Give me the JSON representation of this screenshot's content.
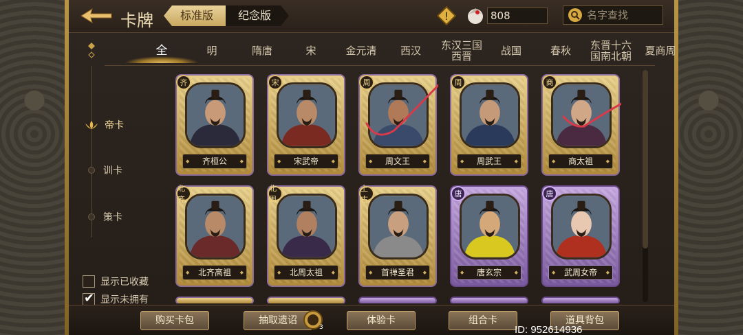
{
  "header": {
    "title": "卡牌",
    "version_tabs": [
      {
        "label": "标准版",
        "active": true
      },
      {
        "label": "纪念版",
        "active": false
      }
    ],
    "currency_amount": "808",
    "search_placeholder": "名字查找"
  },
  "era_tabs": [
    {
      "label": "全",
      "active": true
    },
    {
      "label": "明"
    },
    {
      "label": "隋唐"
    },
    {
      "label": "宋"
    },
    {
      "label": "金元清"
    },
    {
      "label": "西汉"
    },
    {
      "label": "东汉三国\n西晋"
    },
    {
      "label": "战国"
    },
    {
      "label": "春秋"
    },
    {
      "label": "东晋十六\n国南北朝"
    },
    {
      "label": "夏商周"
    }
  ],
  "categories": [
    {
      "label": "帝卡",
      "active": true
    },
    {
      "label": "训卡"
    },
    {
      "label": "策卡"
    }
  ],
  "filters": [
    {
      "label": "显示已收藏",
      "checked": false
    },
    {
      "label": "显示未拥有",
      "checked": true
    }
  ],
  "cards": [
    {
      "name": "齐桓公",
      "era": "齐",
      "tier": "gold",
      "skin": "#c89a78",
      "robe": "#2a2a3a",
      "marked": false
    },
    {
      "name": "宋武帝",
      "era": "宋",
      "tier": "gold",
      "skin": "#b88a68",
      "robe": "#7a2a20",
      "marked": false
    },
    {
      "name": "周文王",
      "era": "周",
      "tier": "gold",
      "skin": "#b07a58",
      "robe": "#3a4a6a",
      "marked": true
    },
    {
      "name": "周武王",
      "era": "周",
      "tier": "gold",
      "skin": "#c49a78",
      "robe": "#2a3a5a",
      "marked": false
    },
    {
      "name": "商太祖",
      "era": "商",
      "tier": "gold",
      "skin": "#d0a888",
      "robe": "#4a2a40",
      "marked": true
    },
    {
      "name": "北齐高祖",
      "era": "北齐",
      "tier": "gold",
      "skin": "#b88a68",
      "robe": "#6a2a2a",
      "marked": false
    },
    {
      "name": "北周太祖",
      "era": "北周",
      "tier": "gold",
      "skin": "#b08060",
      "robe": "#3a2a4a",
      "marked": false
    },
    {
      "name": "首禅圣君",
      "era": "上古",
      "tier": "gold",
      "skin": "#c8a080",
      "robe": "#8a8a8a",
      "marked": false
    },
    {
      "name": "唐玄宗",
      "era": "唐",
      "tier": "purple",
      "skin": "#d4a878",
      "robe": "#d8c820",
      "marked": false
    },
    {
      "name": "武周女帝",
      "era": "唐",
      "tier": "purple",
      "skin": "#e8c8b0",
      "robe": "#b03020",
      "marked": false
    }
  ],
  "bottom_buttons": [
    {
      "label": "购买卡包"
    },
    {
      "label": "抽取遗诏"
    },
    {
      "label": "体验卡"
    },
    {
      "label": "组合卡"
    },
    {
      "label": "道具背包"
    }
  ],
  "coin_badge": "3",
  "player_id": "ID: 952614936",
  "colors": {
    "gold": "#e8d08a",
    "purple": "#c6a8e0",
    "pen_mark": "#d83a4a"
  }
}
